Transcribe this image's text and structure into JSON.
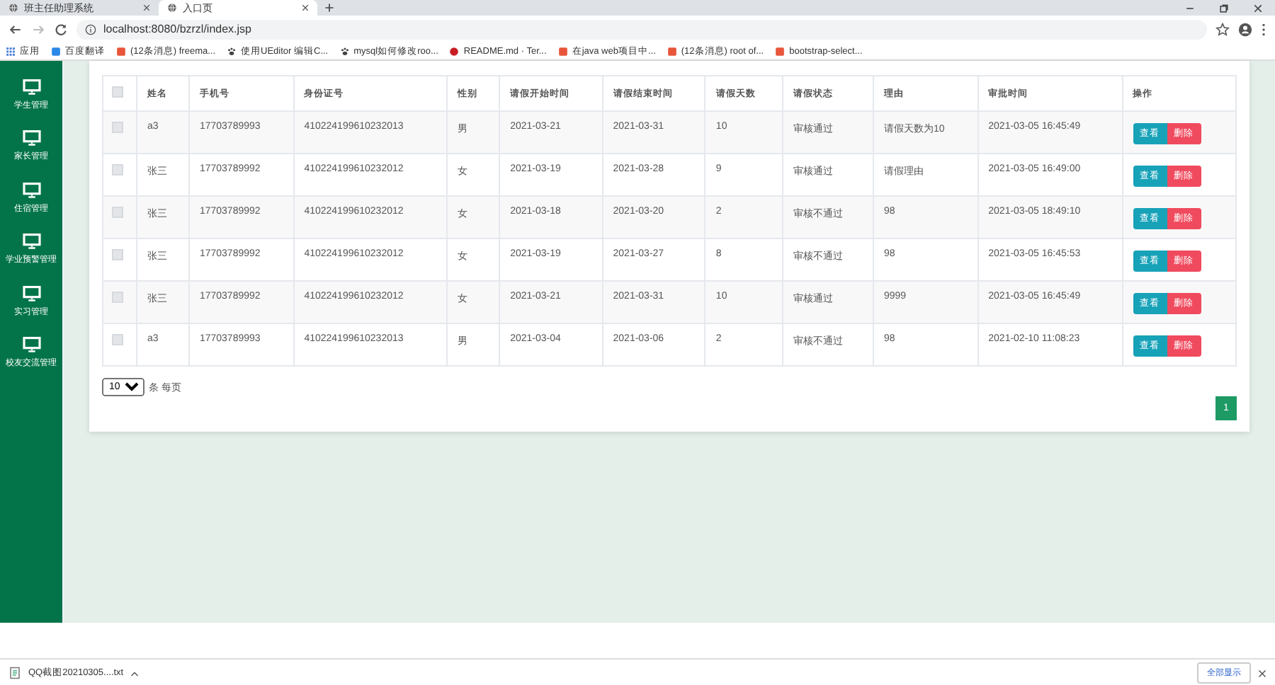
{
  "browser": {
    "tabs": [
      {
        "title": "班主任助理系统",
        "selected": false
      },
      {
        "title": "入口页",
        "selected": true
      }
    ],
    "address": "localhost:8080/bzrzl/index.jsp",
    "bookmarks": [
      {
        "label": "应用",
        "kind": "apps"
      },
      {
        "label": "百度翻译",
        "kind": "blue"
      },
      {
        "label": "(12条消息) freema...",
        "kind": "csdn"
      },
      {
        "label": "使用UEditor 编辑C...",
        "kind": "paw"
      },
      {
        "label": "mysql如何修改roo...",
        "kind": "paw"
      },
      {
        "label": "README.md · Ter...",
        "kind": "gitee"
      },
      {
        "label": "在java web项目中...",
        "kind": "csdn"
      },
      {
        "label": "(12条消息) root of...",
        "kind": "csdn"
      },
      {
        "label": "bootstrap-select...",
        "kind": "csdn"
      }
    ]
  },
  "sidebar": {
    "items": [
      {
        "label": "学生管理"
      },
      {
        "label": "家长管理"
      },
      {
        "label": "住宿管理"
      },
      {
        "label": "学业预警管理"
      },
      {
        "label": "实习管理"
      },
      {
        "label": "校友交流管理"
      }
    ]
  },
  "table": {
    "select_all_checked": false,
    "columns": [
      "姓名",
      "手机号",
      "身份证号",
      "性别",
      "请假开始时间",
      "请假结束时间",
      "请假天数",
      "请假状态",
      "理由",
      "审批时间",
      "操作"
    ],
    "rows": [
      {
        "checked": false,
        "cells": [
          "a3",
          "17703789993",
          "410224199610232013",
          "男",
          "2021-03-21",
          "2021-03-31",
          "10",
          "审核通过",
          "请假天数为10",
          "2021-03-05 16:45:49"
        ],
        "actions": [
          "查看",
          "删除"
        ]
      },
      {
        "checked": false,
        "cells": [
          "张三",
          "17703789992",
          "410224199610232012",
          "女",
          "2021-03-19",
          "2021-03-28",
          "9",
          "审核通过",
          "请假理由",
          "2021-03-05 16:49:00"
        ],
        "actions": [
          "查看",
          "删除"
        ]
      },
      {
        "checked": false,
        "cells": [
          "张三",
          "17703789992",
          "410224199610232012",
          "女",
          "2021-03-18",
          "2021-03-20",
          "2",
          "审核不通过",
          "98",
          "2021-03-05 18:49:10"
        ],
        "actions": [
          "查看",
          "删除"
        ]
      },
      {
        "checked": false,
        "cells": [
          "张三",
          "17703789992",
          "410224199610232012",
          "女",
          "2021-03-19",
          "2021-03-27",
          "8",
          "审核不通过",
          "98",
          "2021-03-05 16:45:53"
        ],
        "actions": [
          "查看",
          "删除"
        ]
      },
      {
        "checked": false,
        "cells": [
          "张三",
          "17703789992",
          "410224199610232012",
          "女",
          "2021-03-21",
          "2021-03-31",
          "10",
          "审核通过",
          "9999",
          "2021-03-05 16:45:49"
        ],
        "actions": [
          "查看",
          "删除"
        ]
      },
      {
        "checked": false,
        "cells": [
          "a3",
          "17703789993",
          "410224199610232013",
          "男",
          "2021-03-04",
          "2021-03-06",
          "2",
          "审核不通过",
          "98",
          "2021-02-10 11:08:23"
        ],
        "actions": [
          "查看",
          "删除"
        ]
      }
    ]
  },
  "page_size": {
    "value": "10",
    "label": "条 每页"
  },
  "pagination": [
    {
      "label": "1",
      "selected": true
    }
  ],
  "download_bar": {
    "file": "QQ截图20210305....txt",
    "show_all": "全部显示"
  }
}
